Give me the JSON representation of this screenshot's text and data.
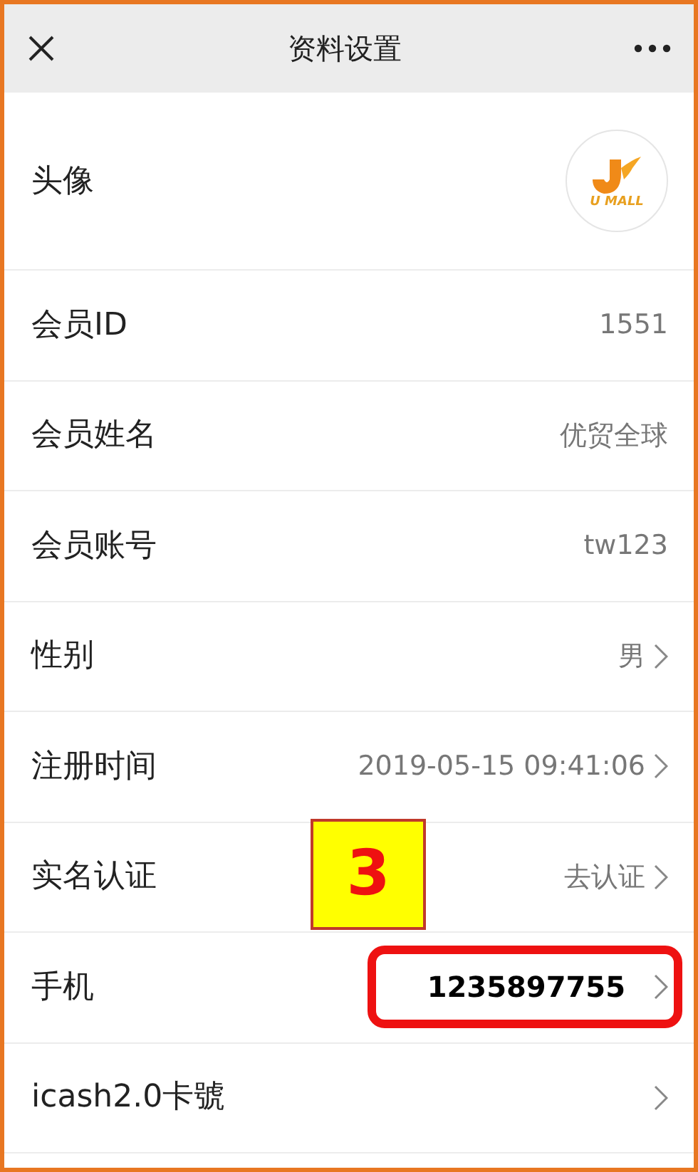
{
  "header": {
    "title": "资料设置"
  },
  "rows": [
    {
      "kind": "avatar",
      "label": "头像",
      "logo_text": "U MALL",
      "chevron": false
    },
    {
      "kind": "value",
      "label": "会员ID",
      "value": "1551",
      "chevron": false,
      "highlighted": false
    },
    {
      "kind": "value",
      "label": "会员姓名",
      "value": "优贸全球",
      "chevron": false,
      "highlighted": false
    },
    {
      "kind": "value",
      "label": "会员账号",
      "value": "tw123",
      "chevron": false,
      "highlighted": false
    },
    {
      "kind": "value",
      "label": "性别",
      "value": "男",
      "chevron": true,
      "highlighted": false
    },
    {
      "kind": "value",
      "label": "注册时间",
      "value": "2019-05-15 09:41:06",
      "chevron": true,
      "highlighted": false
    },
    {
      "kind": "value",
      "label": "实名认证",
      "value": "去认证",
      "chevron": true,
      "highlighted": false
    },
    {
      "kind": "value",
      "label": "手机",
      "value": "1235897755",
      "chevron": true,
      "highlighted": true
    },
    {
      "kind": "value",
      "label": "icash2.0卡號",
      "chevron": true,
      "highlighted": false
    }
  ],
  "annotation": {
    "number": "3"
  }
}
